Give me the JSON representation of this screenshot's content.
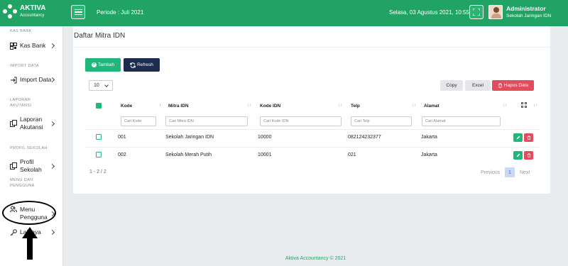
{
  "brand": {
    "name": "AKTIVA",
    "sub": "Accountancy"
  },
  "topbar": {
    "periode": "Periode : Juli 2021",
    "datetime": "Selasa, 03 Agustus 2021, 10:55:20",
    "user_name": "Administrator",
    "user_school": "Sekolah Jaringan IDN"
  },
  "sidebar": {
    "sections": {
      "kas_bank": "KAS BANK",
      "import_data": "IMPORT DATA",
      "laporan": "LAPORAN AKUTANSI",
      "profil": "PROFIL SEKOLAH",
      "menu": "MENU DAN PENGGUNA"
    },
    "items": {
      "kas_bank": "Kas Bank",
      "import_data": "Import Data",
      "laporan": "Laporan Akutansi",
      "profil": "Profil Sekolah",
      "menu_pengguna": "Menu Pengguna",
      "lainnya": "Lainnya"
    }
  },
  "card": {
    "title": "Daftar Mitra IDN"
  },
  "toolbar": {
    "tambah": "Tambah",
    "refresh": "Refresh",
    "page_size": "10",
    "copy": "Copy",
    "excel": "Excel",
    "hapus": "Hapus Data"
  },
  "table": {
    "columns": [
      "Kode",
      "Mitra IDN",
      "Kode IDN",
      "Telp",
      "Alamat"
    ],
    "filters": [
      "Cari Kode",
      "Cari Mitra IDN",
      "Cari Kode IDN",
      "Cari Telp",
      "Cari Alamat"
    ],
    "rows": [
      {
        "kode": "001",
        "mitra": "Sekolah Jaringan IDN",
        "kode_idn": "10000",
        "telp": "082124232377",
        "alamat": "Jakarta"
      },
      {
        "kode": "002",
        "mitra": "Sekolah Merah Putih",
        "kode_idn": "10001",
        "telp": "021",
        "alamat": "Jakarta"
      }
    ]
  },
  "pagination": {
    "info": "1 - 2 / 2",
    "previous": "Previous",
    "page": "1",
    "next": "Next"
  },
  "footer": "Aktiva Accountancy © 2021"
}
